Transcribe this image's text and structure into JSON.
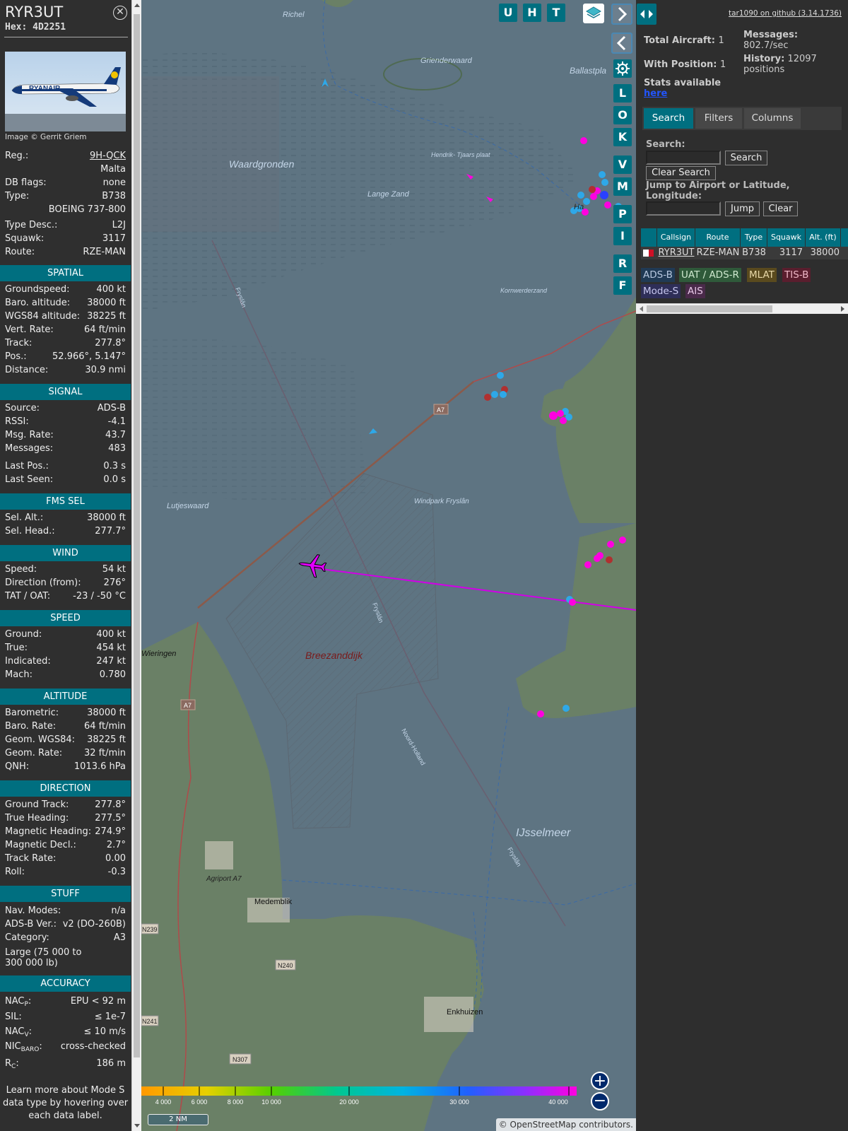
{
  "aircraft": {
    "callsign": "RYR3UT",
    "hex": "Hex: 4D2251",
    "photo_credit": "Image © Gerrit Griem",
    "photo_livery": "RYANAIR",
    "reg_label": "Reg.:",
    "reg": "9H-QCK",
    "country": "Malta",
    "dbflags_label": "DB flags:",
    "dbflags": "none",
    "type_label": "Type:",
    "type": "B738",
    "type_full": "BOEING 737-800",
    "typedesc_label": "Type Desc.:",
    "typedesc": "L2J",
    "squawk_label": "Squawk:",
    "squawk": "3117",
    "route_label": "Route:",
    "route": "RZE-MAN"
  },
  "sections": {
    "spatial": "SPATIAL",
    "signal": "SIGNAL",
    "fms": "FMS SEL",
    "wind": "WIND",
    "speed": "SPEED",
    "altitude": "ALTITUDE",
    "direction": "DIRECTION",
    "stuff": "STUFF",
    "accuracy": "ACCURACY"
  },
  "spatial": [
    [
      "Groundspeed:",
      "400 kt"
    ],
    [
      "Baro. altitude:",
      "38000 ft"
    ],
    [
      "WGS84 altitude:",
      "38225 ft"
    ],
    [
      "Vert. Rate:",
      "64 ft/min"
    ],
    [
      "Track:",
      "277.8°"
    ],
    [
      "Pos.:",
      "52.966°, 5.147°"
    ],
    [
      "Distance:",
      "30.9 nmi"
    ]
  ],
  "signal": [
    [
      "Source:",
      "ADS-B"
    ],
    [
      "RSSI:",
      "-4.1"
    ],
    [
      "Msg. Rate:",
      "43.7"
    ],
    [
      "Messages:",
      "483"
    ],
    [
      "Last Pos.:",
      "0.3 s"
    ],
    [
      "Last Seen:",
      "0.0 s"
    ]
  ],
  "fms": [
    [
      "Sel. Alt.:",
      "38000 ft"
    ],
    [
      "Sel. Head.:",
      "277.7°"
    ]
  ],
  "wind": [
    [
      "Speed:",
      "54 kt"
    ],
    [
      "Direction (from):",
      "276°"
    ],
    [
      "TAT / OAT:",
      "-23 / -50 °C"
    ]
  ],
  "speed": [
    [
      "Ground:",
      "400 kt"
    ],
    [
      "True:",
      "454 kt"
    ],
    [
      "Indicated:",
      "247 kt"
    ],
    [
      "Mach:",
      "0.780"
    ]
  ],
  "altitude": [
    [
      "Barometric:",
      "38000 ft"
    ],
    [
      "Baro. Rate:",
      "64 ft/min"
    ],
    [
      "Geom. WGS84:",
      "38225 ft"
    ],
    [
      "Geom. Rate:",
      "32 ft/min"
    ],
    [
      "QNH:",
      "1013.6 hPa"
    ]
  ],
  "direction": [
    [
      "Ground Track:",
      "277.8°"
    ],
    [
      "True Heading:",
      "277.5°"
    ],
    [
      "Magnetic Heading:",
      "274.9°"
    ],
    [
      "Magnetic Decl.:",
      "2.7°"
    ],
    [
      "Track Rate:",
      "0.00"
    ],
    [
      "Roll:",
      "-0.3"
    ]
  ],
  "stuff": {
    "navmodes_label": "Nav. Modes:",
    "navmodes": "n/a",
    "adsbver_label": "ADS-B Ver.:",
    "adsbver": "v2 (DO-260B)",
    "category_label": "Category:",
    "category": "A3",
    "category_desc": "Large (75 000 to 300 000 lb)"
  },
  "accuracy": {
    "nacp_a": "NAC",
    "nacp_b": "P",
    "nacp_c": ":",
    "nacp": "EPU < 92 m",
    "sil_label": "SIL:",
    "sil": "≤ 1e-7",
    "nacv_a": "NAC",
    "nacv_b": "V",
    "nacv_c": ":",
    "nacv": "≤ 10 m/s",
    "nic_a": "NIC",
    "nic_b": "BARO",
    "nic_c": ":",
    "nic": "cross-checked",
    "rc_a": "R",
    "rc_b": "C",
    "rc_c": ":",
    "rc": "186 m"
  },
  "learn_more": "Learn more about Mode S data type by hovering over each data label.",
  "map": {
    "toolbar": [
      "U",
      "H",
      "T"
    ],
    "side_buttons": [
      "L",
      "O",
      "K",
      "V",
      "M",
      "P",
      "I",
      "R",
      "F"
    ],
    "labels": {
      "richel": "Richel",
      "griend": "Grienderwaard",
      "ballast": "Ballastpla",
      "waard": "Waardgronden",
      "hendrik": "Hendrik-\nTjaars plaat",
      "lange": "Lange Zand",
      "harlingen": "Ha",
      "korn": "Kornwerderzand",
      "lutjes": "Lutjeswaard",
      "windpark": "Windpark\nFryslân",
      "breezand": "Breezanddijk",
      "wieringen": "Wieringen",
      "medemblik": "Medemblik",
      "ijsselmeer": "IJsselmeer",
      "agriport": "Agriport\nA7",
      "enkhuizen": "Enkhuizen",
      "a7": "A7",
      "a7b": "A7",
      "n239": "N239",
      "n240": "N240",
      "n241": "N241",
      "n307": "N307",
      "fryslan1": "Fryslân",
      "fryslan2": "Fryslân",
      "fryslan3": "Fryslân",
      "noord": "Noord-Holland"
    },
    "legend_ticks": [
      "4 000",
      "6 000",
      "8 000",
      "10 000",
      "20 000",
      "30 000",
      "40 000"
    ],
    "scale": "2 NM",
    "attribution": "© OpenStreetMap contributors.",
    "zoom_in": "+",
    "zoom_out": "−"
  },
  "panel": {
    "github": "tar1090 on github (3.14.1736)",
    "total_label": "Total Aircraft:",
    "total": "1",
    "withpos_label": "With Position:",
    "withpos": "1",
    "messages_label": "Messages:",
    "messages": "802.7/sec",
    "history_label": "History:",
    "history": "12097 positions",
    "stats_label": "Stats available",
    "stats_link": "here",
    "tabs": [
      "Search",
      "Filters",
      "Columns"
    ],
    "search_label": "Search:",
    "search_btn": "Search",
    "clear_search": "Clear Search",
    "jump_label": "Jump to Airport or Latitude, Longitude:",
    "jump_btn": "Jump",
    "clear_btn": "Clear",
    "columns": [
      "Callsign",
      "Route",
      "Type",
      "Squawk",
      "Alt. (ft)"
    ],
    "row": {
      "callsign": "RYR3UT",
      "route": "RZE-MAN",
      "type": "B738",
      "squawk": "3117",
      "alt": "38000"
    },
    "sources": [
      "ADS-B",
      "UAT / ADS-R",
      "MLAT",
      "TIS-B",
      "Mode-S",
      "AIS"
    ]
  },
  "colors": {
    "accent": "#006f80",
    "track": "#d100e6",
    "selected_aircraft": "#e100ff"
  }
}
